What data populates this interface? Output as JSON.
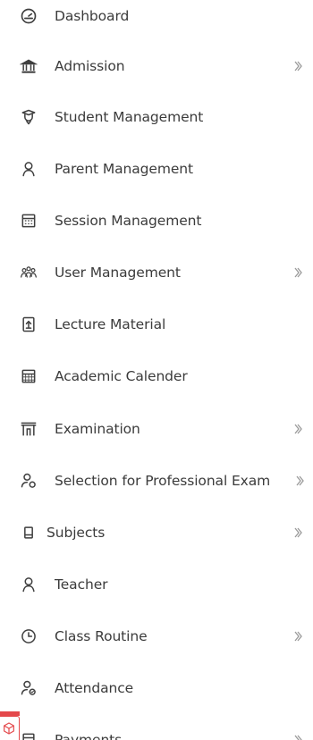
{
  "menu": {
    "items": [
      {
        "label": "Dashboard",
        "icon": "gauge-icon",
        "submenu": false
      },
      {
        "label": "Admission",
        "icon": "institution-icon",
        "submenu": true
      },
      {
        "label": "Student Management",
        "icon": "graduate-icon",
        "submenu": false
      },
      {
        "label": "Parent Management",
        "icon": "person-icon",
        "submenu": false
      },
      {
        "label": "Session Management",
        "icon": "calendar-icon",
        "submenu": false
      },
      {
        "label": "User Management",
        "icon": "users-group-icon",
        "submenu": true
      },
      {
        "label": "Lecture Material",
        "icon": "file-upload-icon",
        "submenu": false
      },
      {
        "label": "Academic Calender",
        "icon": "calendar-grid-icon",
        "submenu": false
      },
      {
        "label": "Examination",
        "icon": "exam-building-icon",
        "submenu": true
      },
      {
        "label": "Selection for Professional Exam",
        "icon": "user-swap-icon",
        "submenu": true
      },
      {
        "label": "Subjects",
        "icon": "book-icon",
        "submenu": true
      },
      {
        "label": "Teacher",
        "icon": "person-icon",
        "submenu": false
      },
      {
        "label": "Class Routine",
        "icon": "clock-icon",
        "submenu": true
      },
      {
        "label": "Attendance",
        "icon": "user-check-icon",
        "submenu": false
      },
      {
        "label": "Payments",
        "icon": "payment-icon",
        "submenu": true
      }
    ]
  },
  "colors": {
    "text": "#3b3b3b",
    "icon": "#3f3f3f",
    "chevron": "#9a9a9a",
    "accent": "#e4484b"
  }
}
